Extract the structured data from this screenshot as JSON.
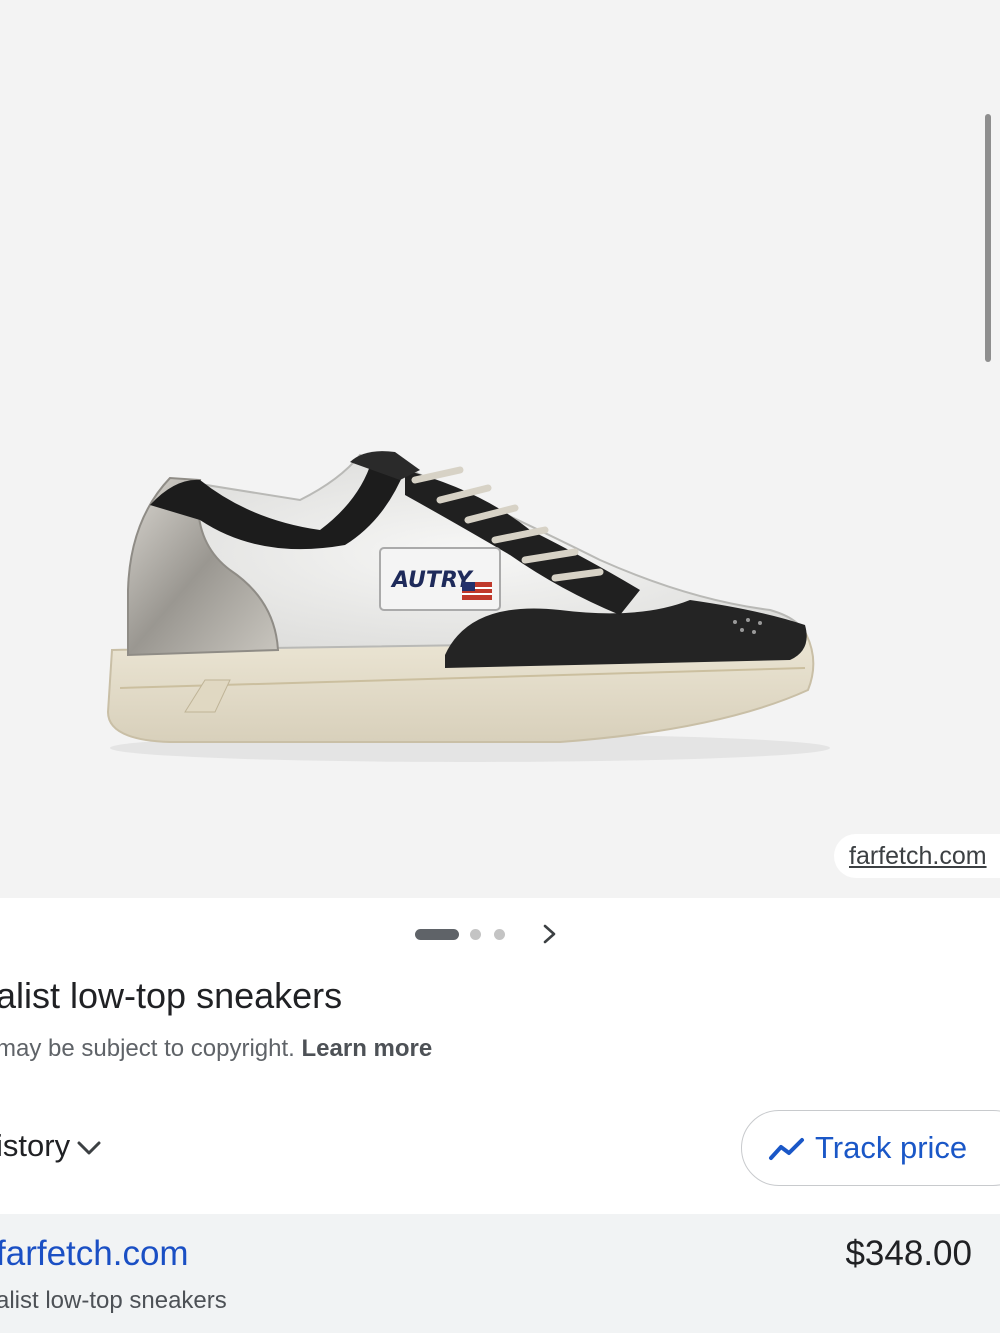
{
  "image": {
    "description_icon": "sneaker-product-image",
    "shoe_brand_text": "AUTRY",
    "source_chip": "farfetch.com"
  },
  "carousel": {
    "pages": 3,
    "current_page": 1
  },
  "product": {
    "title": "alist low-top sneakers",
    "copyright_text": "may be subject to copyright.",
    "learn_more_label": "Learn more"
  },
  "price_history": {
    "label": "istory"
  },
  "track_price": {
    "label": "Track price",
    "icon": "trending-line-icon",
    "color": "#1a57c7"
  },
  "offer": {
    "site": "farfetch.com",
    "price": "$348.00",
    "product_name": "alist low-top sneakers"
  },
  "colors": {
    "image_bg": "#f3f3f3",
    "offer_bg": "#f1f3f4",
    "link_blue": "#1a4fc4"
  }
}
